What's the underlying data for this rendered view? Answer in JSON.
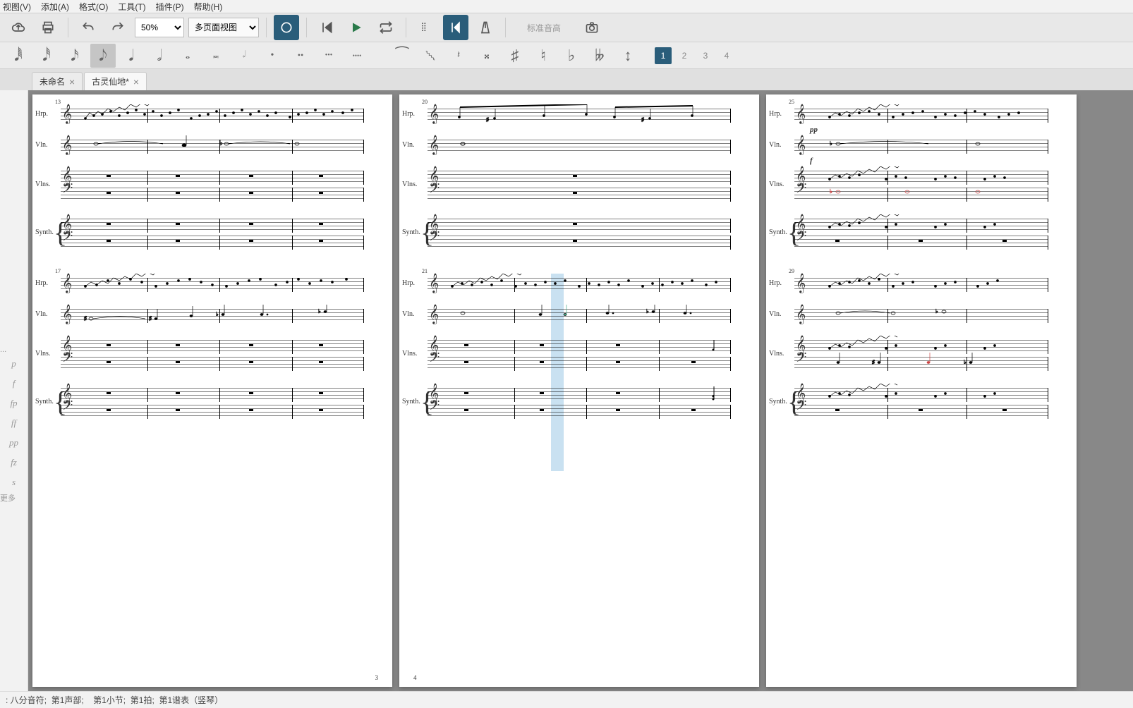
{
  "menu": {
    "view": "视图(V)",
    "add": "添加(A)",
    "format": "格式(O)",
    "tools": "工具(T)",
    "plugins": "插件(P)",
    "help": "帮助(H)"
  },
  "toolbar": {
    "zoom": "50%",
    "view_mode": "多页面视图",
    "pitch_label": "标准音高"
  },
  "voices": {
    "v1": "1",
    "v2": "2",
    "v3": "3",
    "v4": "4"
  },
  "tabs": [
    {
      "title": "未命名",
      "closable": true,
      "active": false
    },
    {
      "title": "古灵仙地*",
      "closable": true,
      "active": true
    }
  ],
  "palette": {
    "dynamics": [
      "p",
      "f",
      "fp",
      "ff",
      "pp",
      "fz",
      "s"
    ],
    "more": "更多",
    "dots": "..."
  },
  "instruments": {
    "hrp": "Hrp.",
    "vln": "Vln.",
    "vlns": "Vlns.",
    "synth": "Synth."
  },
  "measure_numbers": {
    "p1a": "13",
    "p1b": "17",
    "p2a": "20",
    "p2b": "21",
    "p3a": "25",
    "p3b": "29"
  },
  "page_numbers": {
    "p1": "3",
    "p2": "4"
  },
  "dynamics": {
    "pp": "pp",
    "f": "f"
  },
  "statusbar": {
    "note_value": "八分音符",
    "voice": "第1声部",
    "measure": "第1小节",
    "beat": "第1拍",
    "staff": "第1谱表",
    "instrument": "（竖琴）"
  }
}
